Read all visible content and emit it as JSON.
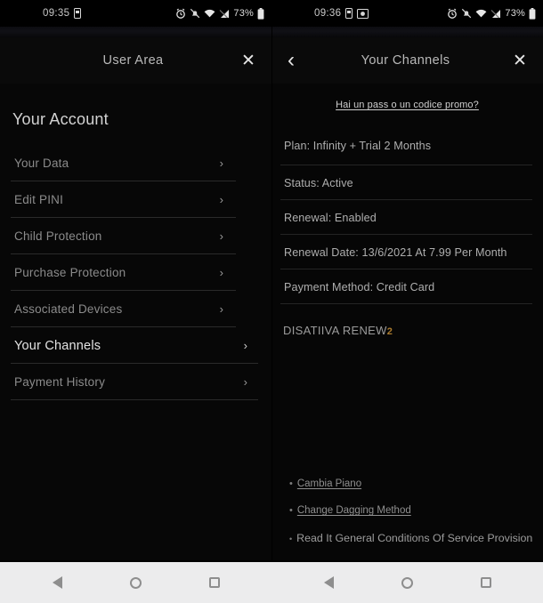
{
  "status_bar_left": {
    "time": "09:35",
    "icons": [
      "sim-card-icon"
    ],
    "right_icons": [
      "alarm-icon",
      "notifications-muted-icon",
      "wifi-icon",
      "signal-icon"
    ],
    "battery_percent": "73%",
    "battery_icon": "battery-icon"
  },
  "status_bar_right": {
    "time": "09:36",
    "icons": [
      "sim-card-icon",
      "screenshot-icon"
    ],
    "right_icons": [
      "alarm-icon",
      "notifications-muted-icon",
      "wifi-icon",
      "signal-icon"
    ],
    "battery_percent": "73%",
    "battery_icon": "battery-icon"
  },
  "left_pane": {
    "appbar": {
      "title": "User Area",
      "close_label": "✕",
      "close_icon": "close-icon"
    },
    "section_title": "Your Account",
    "menu_items": [
      {
        "label": "Your Data",
        "chevron": "›",
        "selected": false
      },
      {
        "label": "Edit PINI",
        "chevron": "›",
        "selected": false
      },
      {
        "label": "Child Protection",
        "chevron": "›",
        "selected": false
      },
      {
        "label": "Purchase Protection",
        "chevron": "›",
        "selected": false
      },
      {
        "label": "Associated Devices",
        "chevron": "›",
        "selected": false
      },
      {
        "label": "Your Channels",
        "chevron": "›",
        "selected": true
      },
      {
        "label": "Payment History",
        "chevron": "›",
        "selected": false
      }
    ]
  },
  "right_pane": {
    "appbar": {
      "title": "Your Channels",
      "back_label": "‹",
      "back_icon": "chevron-left-icon",
      "close_label": "✕",
      "close_icon": "close-icon"
    },
    "promo_link": "Hai un pass o un codice promo?",
    "details": [
      {
        "text": "Plan: Infinity + Trial 2 Months"
      },
      {
        "text": "Status: Active"
      },
      {
        "text": "Renewal: Enabled"
      },
      {
        "text": "Renewal Date: 13/6/2021 At 7.99 Per Month"
      },
      {
        "text": "Payment Method: Credit Card"
      }
    ],
    "deactivate": {
      "main": "DISATIIVA RENEW",
      "superscript": "2",
      "superscript_color": "#a97a2e"
    },
    "bullets": [
      {
        "marker": "•",
        "label": "Cambia Piano",
        "underlined": true
      },
      {
        "marker": "•",
        "label": "Change Dagging Method",
        "underlined": true
      },
      {
        "marker": "•",
        "label": "Read It General Conditions Of Service Provision",
        "underlined": false
      }
    ]
  },
  "nav_bar": {
    "back_icon": "back-triangle-icon",
    "home_icon": "home-circle-icon",
    "recents_icon": "recents-square-icon"
  }
}
